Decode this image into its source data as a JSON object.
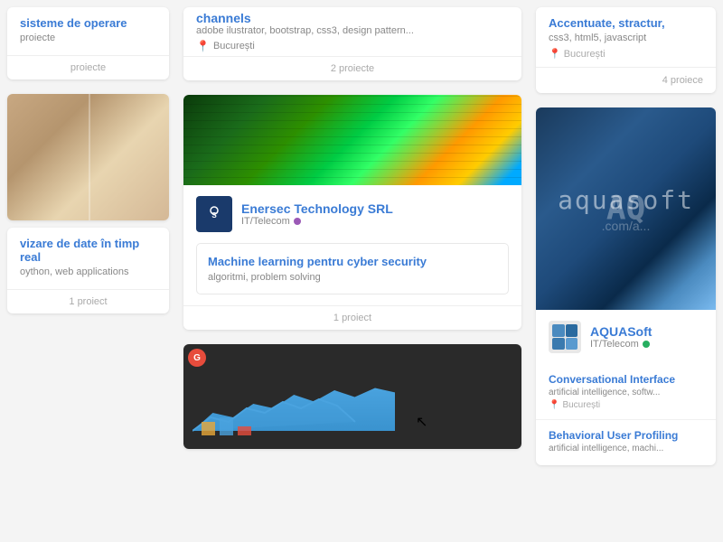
{
  "layout": {
    "columns": [
      "left",
      "middle",
      "right"
    ]
  },
  "left": {
    "card1": {
      "company_name": "sisteme de operare",
      "skills": "proiecte",
      "projects_label": "proiecte"
    },
    "card2": {
      "title": "vizare de date în timp real",
      "skills": "oython, web applications",
      "projects_label": "1 proiect"
    }
  },
  "middle": {
    "card_top": {
      "company_name": "channels",
      "skills": "adobe ilustrator, bootstrap, css3, design pattern...",
      "location": "București",
      "projects_count": "2 proiecte"
    },
    "card_enersec": {
      "company_name": "Enersec Technology SRL",
      "category": "IT/Telecom",
      "project_title": "Machine learning pentru cyber security",
      "project_skills": "algoritmi, problem solving",
      "projects_count": "1 proiect"
    },
    "card_dashboard": {
      "image_alt": "dashboard map view"
    }
  },
  "right": {
    "card_top": {
      "company_name": "Accentuate, stractur,",
      "skills": "css3, html5, javascript",
      "location": "București",
      "projects_count": "4 proiece"
    },
    "card_aquasoft": {
      "company_name": "AQUASoft",
      "category": "IT/Telecom",
      "project1_title": "Conversational Interface",
      "project1_skills": "artificial intelligence, softw...",
      "project1_location": "București",
      "project2_title": "Behavioral User Profiling",
      "project2_skills": "artificial intelligence, machi..."
    }
  }
}
